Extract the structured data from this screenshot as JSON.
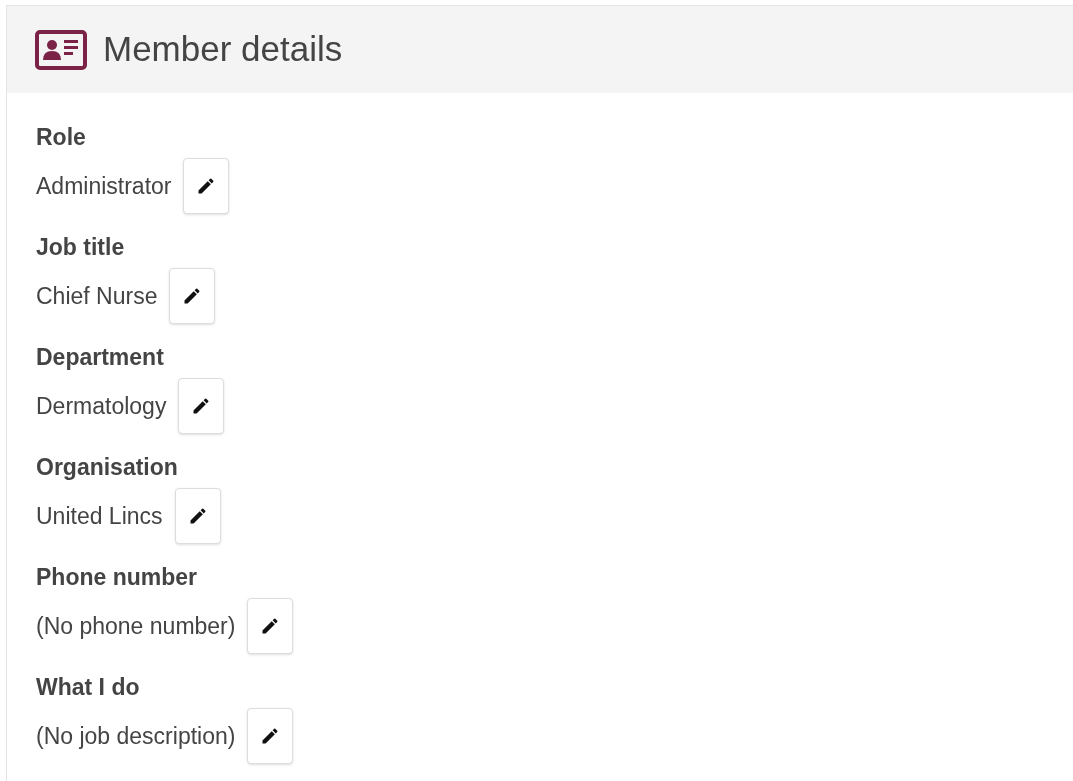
{
  "panel": {
    "title": "Member details"
  },
  "fields": [
    {
      "label": "Role",
      "value": "Administrator"
    },
    {
      "label": "Job title",
      "value": "Chief Nurse"
    },
    {
      "label": "Department",
      "value": "Dermatology"
    },
    {
      "label": "Organisation",
      "value": "United Lincs"
    },
    {
      "label": "Phone number",
      "value": "(No phone number)"
    },
    {
      "label": "What I do",
      "value": "(No job description)"
    }
  ]
}
